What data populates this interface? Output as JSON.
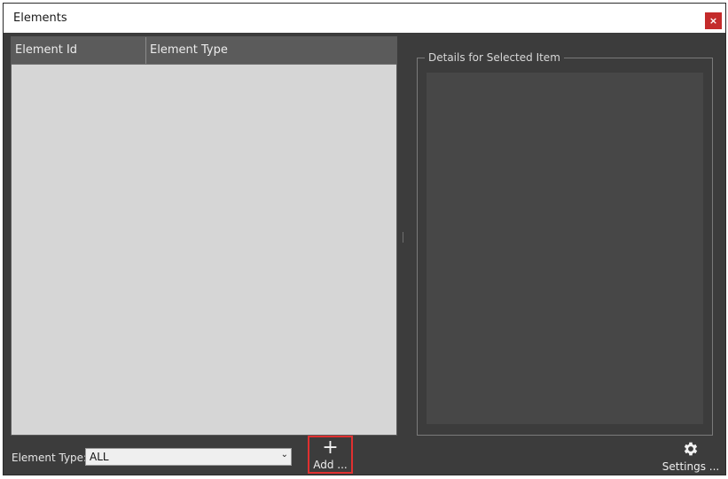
{
  "window": {
    "title": "Elements",
    "close_glyph": "×"
  },
  "list": {
    "columns": [
      "Element Id",
      "Element Type"
    ],
    "rows": []
  },
  "details": {
    "title": "Details for Selected Item"
  },
  "filter": {
    "label": "Element Type:",
    "selected": "ALL",
    "dropdown_glyph": "⌄"
  },
  "actions": {
    "add_icon": "plus-icon",
    "add_glyph": "+",
    "add_label": "Add ...",
    "settings_icon": "gear-icon",
    "settings_label": "Settings ..."
  },
  "colors": {
    "window_bg": "#3c3c3c",
    "list_bg": "#d6d6d6",
    "header_bg": "#5b5b5b",
    "details_bg": "#474747",
    "close_bg": "#c42b2b",
    "highlight": "#e03030"
  }
}
